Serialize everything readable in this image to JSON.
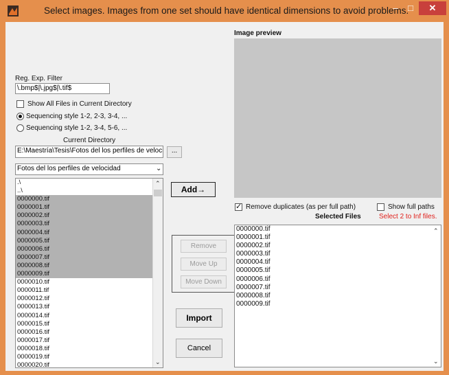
{
  "window": {
    "title": "Select images. Images from one set should have identical dimensions to avoid problems.",
    "minimize_glyph": "–",
    "maximize_glyph": "□",
    "close_glyph": "✕"
  },
  "filter": {
    "label": "Reg. Exp. Filter",
    "value": "\\.bmp$|\\.jpg$|\\.tif$"
  },
  "show_all": {
    "label": "Show All Files in Current Directory",
    "checked": false
  },
  "sequencing": {
    "option1": "Sequencing style 1-2, 2-3, 3-4, ...",
    "option2": "Sequencing style 1-2, 3-4, 5-6, ...",
    "selected": 1
  },
  "current_directory": {
    "label": "Current Directory",
    "value": "E:\\Maestría\\Tesis\\Fotos del los perfiles de velocidad",
    "browse_label": "...",
    "dropdown_value": "Fotos del los perfiles de velocidad"
  },
  "file_list": {
    "items": [
      ".\\",
      "..\\",
      "0000000.tif",
      "0000001.tif",
      "0000002.tif",
      "0000003.tif",
      "0000004.tif",
      "0000005.tif",
      "0000006.tif",
      "0000007.tif",
      "0000008.tif",
      "0000009.tif",
      "0000010.tif",
      "0000011.tif",
      "0000012.tif",
      "0000013.tif",
      "0000014.tif",
      "0000015.tif",
      "0000016.tif",
      "0000017.tif",
      "0000018.tif",
      "0000019.tif",
      "0000020.tif"
    ],
    "selected_items": [
      "0000000.tif",
      "0000001.tif",
      "0000002.tif",
      "0000003.tif",
      "0000004.tif",
      "0000005.tif",
      "0000006.tif",
      "0000007.tif",
      "0000008.tif",
      "0000009.tif"
    ]
  },
  "buttons": {
    "add": "Add→",
    "remove": "Remove",
    "move_up": "Move Up",
    "move_down": "Move Down",
    "import": "Import",
    "cancel": "Cancel"
  },
  "preview": {
    "label": "Image preview"
  },
  "remove_duplicates": {
    "label": "Remove duplicates (as per full path)",
    "checked": true
  },
  "show_full_paths": {
    "label": "Show full paths",
    "checked": false
  },
  "selected_files": {
    "header": "Selected Files",
    "hint": "Select 2 to Inf files.",
    "hint_color": "#e0201b",
    "items": [
      "0000000.tif",
      "0000001.tif",
      "0000002.tif",
      "0000003.tif",
      "0000004.tif",
      "0000005.tif",
      "0000006.tif",
      "0000007.tif",
      "0000008.tif",
      "0000009.tif"
    ]
  },
  "colors": {
    "titlebar": "#e58f4c",
    "preview_bg": "#c6c6c6",
    "list_selection": "#b2b2b2"
  }
}
